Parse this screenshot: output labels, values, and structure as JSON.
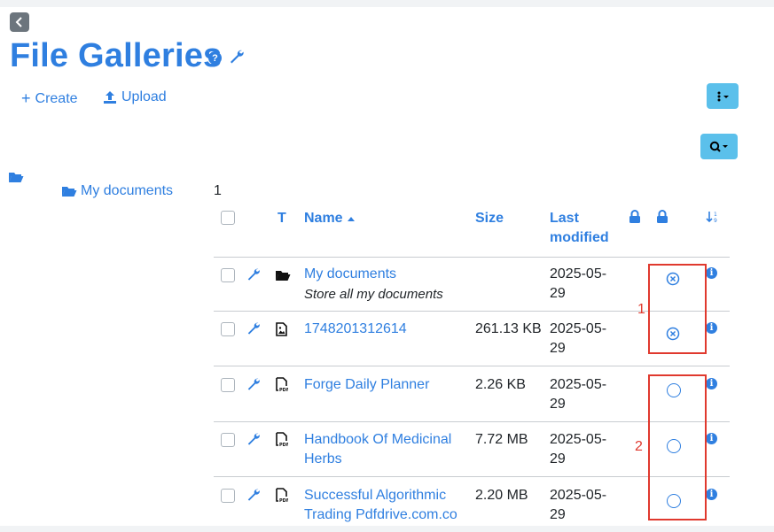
{
  "page": {
    "title": "File Galleries",
    "back_icon": "chevron-left-icon",
    "help_icon_text": "?"
  },
  "toolbar": {
    "create_label": "Create",
    "upload_label": "Upload",
    "actions_icon": "kebab-menu-icon",
    "search_icon": "search-icon"
  },
  "tree": {
    "child_label": "My documents",
    "count": "1"
  },
  "table": {
    "headers": {
      "type": "T",
      "name": "Name",
      "size": "Size",
      "last_modified_line1": "Last",
      "last_modified_line2": "modified"
    },
    "rows": [
      {
        "name": "My documents",
        "description": "Store all my documents",
        "size": "",
        "date_line1": "2025-05-",
        "date_line2": "29",
        "type_icon": "folder-open-icon",
        "status_icon": "circle-x-icon"
      },
      {
        "name": "1748201312614",
        "description": "",
        "size": "261.13 KB",
        "date_line1": "2025-05-",
        "date_line2": "29",
        "type_icon": "image-file-icon",
        "status_icon": "circle-x-icon"
      },
      {
        "name": "Forge Daily Planner",
        "name_line2": "",
        "size": "2.26 KB",
        "date_line1": "2025-05-",
        "date_line2": "29",
        "type_icon": "pdf-file-icon",
        "status_icon": "circle-icon"
      },
      {
        "name": "Handbook Of Medicinal",
        "name_line2": "Herbs",
        "size": "7.72 MB",
        "date_line1": "2025-05-",
        "date_line2": "29",
        "type_icon": "pdf-file-icon",
        "status_icon": "circle-icon"
      },
      {
        "name": "Successful Algorithmic",
        "name_line2": "Trading Pdfdrive.com.co",
        "size": "2.20 MB",
        "date_line1": "2025-05-",
        "date_line2": "29",
        "type_icon": "pdf-file-icon",
        "status_icon": "circle-icon"
      }
    ]
  },
  "annotations": {
    "label_1": "1",
    "label_2": "2",
    "color": "#e0392e"
  },
  "colors": {
    "accent": "#2f7fe0",
    "button_info": "#5bc0eb"
  }
}
